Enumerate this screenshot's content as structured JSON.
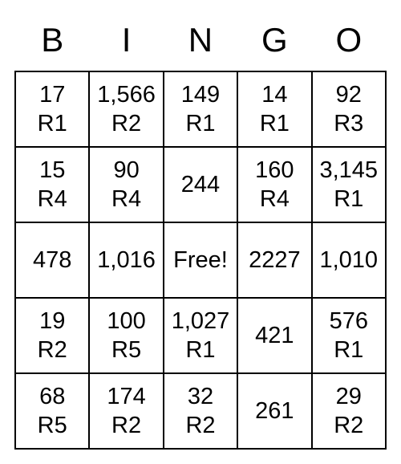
{
  "headers": [
    "B",
    "I",
    "N",
    "G",
    "O"
  ],
  "free_label": "Free!",
  "grid": [
    [
      {
        "value": "17",
        "sub": "R1"
      },
      {
        "value": "1,566",
        "sub": "R2"
      },
      {
        "value": "149",
        "sub": "R1"
      },
      {
        "value": "14",
        "sub": "R1"
      },
      {
        "value": "92",
        "sub": "R3"
      }
    ],
    [
      {
        "value": "15",
        "sub": "R4"
      },
      {
        "value": "90",
        "sub": "R4"
      },
      {
        "value": "244",
        "sub": ""
      },
      {
        "value": "160",
        "sub": "R4"
      },
      {
        "value": "3,145",
        "sub": "R1"
      }
    ],
    [
      {
        "value": "478",
        "sub": ""
      },
      {
        "value": "1,016",
        "sub": ""
      },
      {
        "value": "FREE",
        "sub": ""
      },
      {
        "value": "2227",
        "sub": ""
      },
      {
        "value": "1,010",
        "sub": ""
      }
    ],
    [
      {
        "value": "19",
        "sub": "R2"
      },
      {
        "value": "100",
        "sub": "R5"
      },
      {
        "value": "1,027",
        "sub": "R1"
      },
      {
        "value": "421",
        "sub": ""
      },
      {
        "value": "576",
        "sub": "R1"
      }
    ],
    [
      {
        "value": "68",
        "sub": "R5"
      },
      {
        "value": "174",
        "sub": "R2"
      },
      {
        "value": "32",
        "sub": "R2"
      },
      {
        "value": "261",
        "sub": ""
      },
      {
        "value": "29",
        "sub": "R2"
      }
    ]
  ]
}
